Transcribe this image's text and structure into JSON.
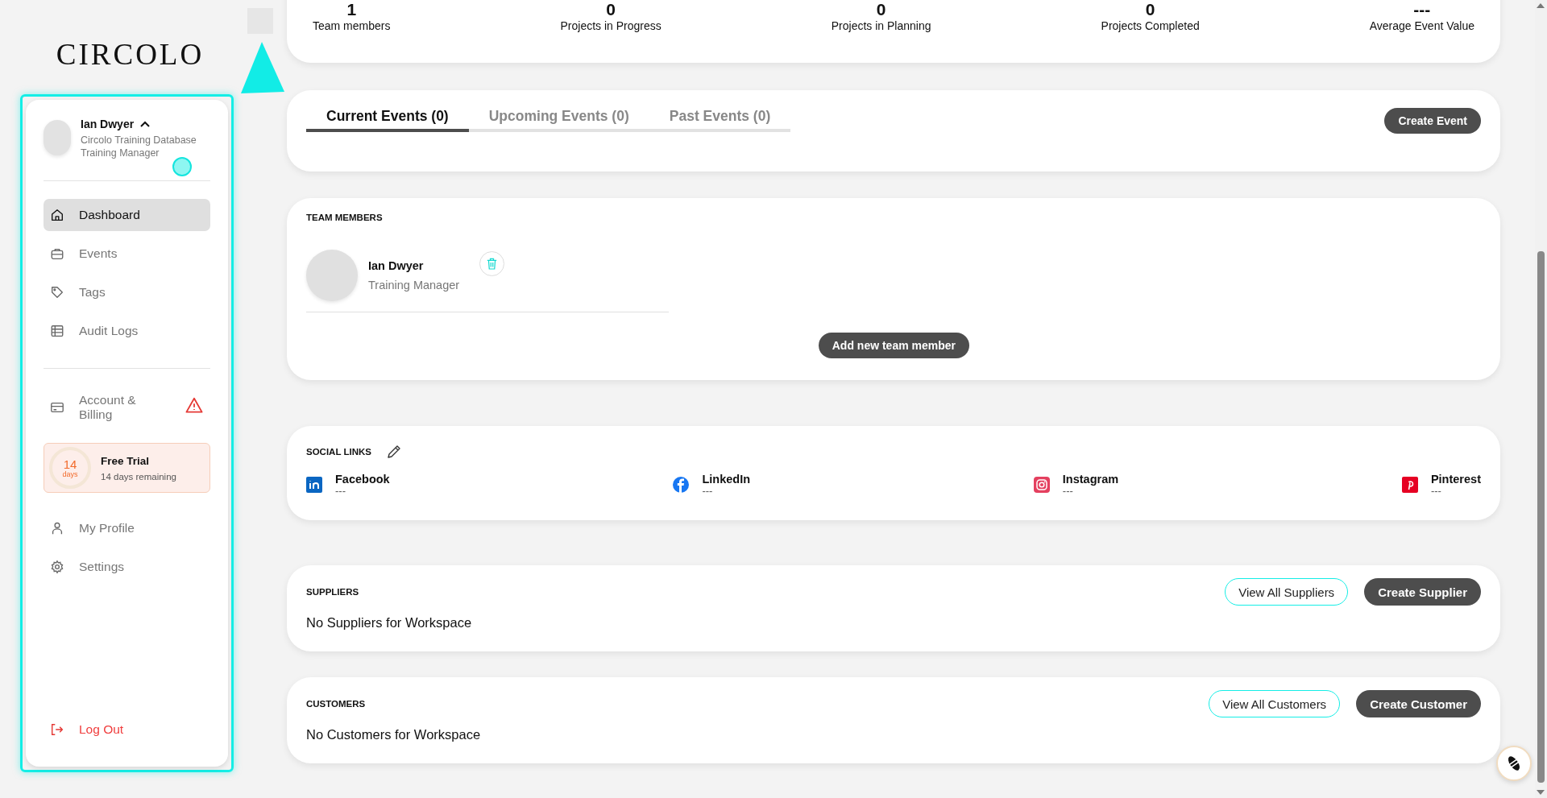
{
  "brand": {
    "logo": "CIRCOLO"
  },
  "user": {
    "name": "Ian Dwyer",
    "workspace": "Circolo Training Database",
    "role": "Training Manager",
    "expanded": true
  },
  "nav": [
    {
      "label": "Dashboard",
      "selected": true
    },
    {
      "label": "Events",
      "selected": false
    },
    {
      "label": "Tags",
      "selected": false
    },
    {
      "label": "Audit Logs",
      "selected": false
    }
  ],
  "account": {
    "label": "Account & Billing",
    "warning": true,
    "selected": false
  },
  "trial": {
    "count": "14",
    "unit": "days",
    "title": "Free Trial",
    "remaining": "14 days remaining"
  },
  "profile_nav": [
    {
      "label": "My Profile",
      "selected": false
    },
    {
      "label": "Settings",
      "selected": false
    }
  ],
  "logout": {
    "label": "Log Out"
  },
  "stats": [
    {
      "value": "1",
      "label": "Team members"
    },
    {
      "value": "0",
      "label": "Projects in Progress"
    },
    {
      "value": "0",
      "label": "Projects in Planning"
    },
    {
      "value": "0",
      "label": "Projects Completed"
    },
    {
      "value": "---",
      "label": "Average Event Value"
    }
  ],
  "tabs": [
    {
      "label": "Current Events (0)",
      "selected": true
    },
    {
      "label": "Upcoming Events (0)",
      "selected": false
    },
    {
      "label": "Past Events (0)",
      "selected": false
    }
  ],
  "create_event": "Create Event",
  "team": {
    "title": "TEAM MEMBERS",
    "members": [
      {
        "name": "Ian Dwyer",
        "role": "Training Manager"
      }
    ],
    "add_button": "Add new team member"
  },
  "social": {
    "title": "SOCIAL LINKS",
    "links": [
      {
        "name": "Facebook",
        "value": "---"
      },
      {
        "name": "LinkedIn",
        "value": "---"
      },
      {
        "name": "Instagram",
        "value": "---"
      },
      {
        "name": "Pinterest",
        "value": "---"
      }
    ]
  },
  "suppliers": {
    "title": "SUPPLIERS",
    "view_button": "View All Suppliers",
    "create_button": "Create Supplier",
    "empty": "No Suppliers for Workspace"
  },
  "customers": {
    "title": "CUSTOMERS",
    "view_button": "View All Customers",
    "create_button": "Create Customer",
    "empty": "No Customers for Workspace"
  }
}
